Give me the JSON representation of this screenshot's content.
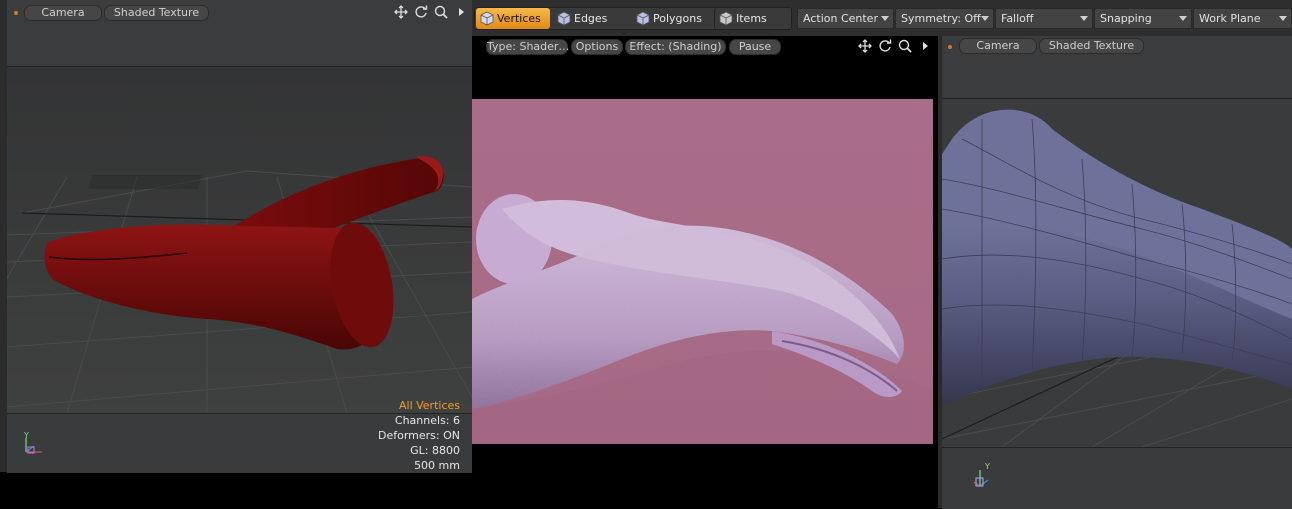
{
  "left_viewport": {
    "camera_label": "Camera",
    "shading_label": "Shaded Texture",
    "stats": {
      "selection_mode": "All Vertices",
      "channels": "Channels: 6",
      "deformers": "Deformers: ON",
      "gl": "GL: 8800",
      "scale": "500 mm"
    },
    "axis_label": "Y"
  },
  "toolbar": {
    "modes": [
      "Vertices",
      "Edges",
      "Polygons",
      "Items"
    ],
    "active_mode": "Vertices",
    "dropdowns": [
      "Action Center",
      "Symmetry: Off",
      "Falloff",
      "Snapping",
      "Work Plane"
    ]
  },
  "preview_viewport": {
    "type_label": "Type: Shader…",
    "options_label": "Options",
    "effect_label": "Effect: (Shading)",
    "pause_label": "Pause",
    "background_color": "#a86d88"
  },
  "right_viewport": {
    "camera_label": "Camera",
    "shading_label": "Shaded Texture",
    "axis_label": "Y"
  },
  "icons": [
    "move-view-icon",
    "rotate-view-icon",
    "zoom-view-icon",
    "viewport-menu-arrow-icon"
  ],
  "colors": {
    "accent_orange": "#f0a020",
    "hammer_red": "#6e0d0d",
    "hammer_lilac": "#c6a8d0",
    "hammer_blue": "#5c5c80"
  }
}
